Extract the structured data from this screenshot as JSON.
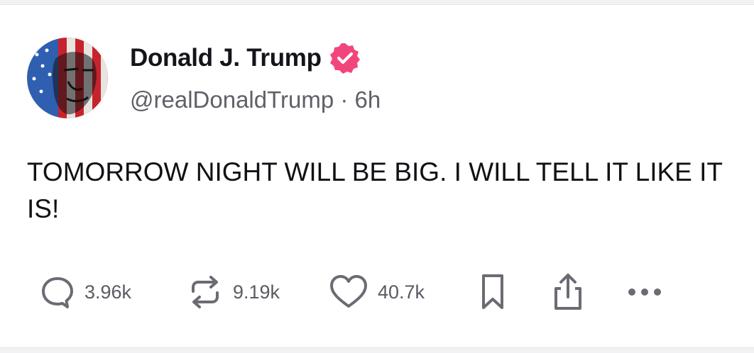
{
  "post": {
    "author": {
      "display_name": "Donald J. Trump",
      "verified": true,
      "handle": "@realDonaldTrump",
      "separator": "·",
      "time_ago": "6h",
      "handle_line": "@realDonaldTrump · 6h"
    },
    "text": "TOMORROW NIGHT WILL BE BIG. I WILL TELL IT LIKE IT IS!",
    "actions": {
      "replies": "3.96k",
      "reposts": "9.19k",
      "likes": "40.7k"
    }
  },
  "colors": {
    "verified_badge": "#f2457c",
    "icon_gray": "#6a6b73",
    "muted_text": "#5f6068",
    "primary_text": "#14141a"
  },
  "icons": {
    "reply": "speech-bubble-icon",
    "repost": "repost-arrows-icon",
    "like": "heart-icon",
    "bookmark": "bookmark-icon",
    "share": "share-upload-icon",
    "more": "more-dots-icon",
    "verified": "verified-badge-icon"
  }
}
